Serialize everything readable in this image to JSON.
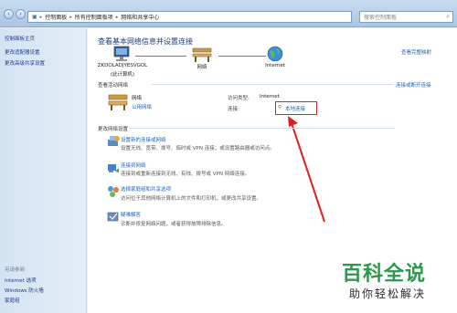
{
  "address": {
    "crumbs": [
      "控制面板",
      "所有控制面板项",
      "网络和共享中心"
    ],
    "search_placeholder": "搜索控制面板"
  },
  "sidebar": {
    "items": [
      "控制面板主页",
      "更改适配器设置",
      "更改高级共享设置"
    ],
    "see_also_title": "另请参阅",
    "see_also": [
      "Internet 选项",
      "Windows 防火墙",
      "家庭组"
    ]
  },
  "main": {
    "title": "查看基本网络信息并设置连接",
    "full_map_link": "查看完整映射",
    "map": {
      "computer_name": "ZKDOLADJYESVGOL",
      "computer_sub": "(此计算机)",
      "network": "网络",
      "internet": "Internet"
    },
    "active_header": "查看活动网络",
    "connect_disconnect_link": "连接或断开连接",
    "active_network": {
      "name": "网络",
      "type": "公用网络",
      "access_label": "访问类型:",
      "access_value": "Internet",
      "conn_label": "连接:",
      "conn_value": "本地连接"
    },
    "change_header": "更改网络设置",
    "tasks": [
      {
        "title": "设置新的连接或网络",
        "desc": "设置无线、宽带、拨号、临时或 VPN 连接；或设置路由器或访问点。"
      },
      {
        "title": "连接到网络",
        "desc": "连接到或重新连接到无线、有线、拨号或 VPN 网络连接。"
      },
      {
        "title": "选择家庭组和共享选项",
        "desc": "访问位于其他网络计算机上的文件和打印机，或更改共享设置。"
      },
      {
        "title": "疑难解答",
        "desc": "诊断并修复网络问题，或者获得故障排除信息。"
      }
    ]
  },
  "watermark": {
    "title": "百科全说",
    "subtitle": "助你轻松解决"
  },
  "colors": {
    "link": "#1a62b8",
    "callout": "#e02020",
    "watermark": "#2a9a4a"
  }
}
